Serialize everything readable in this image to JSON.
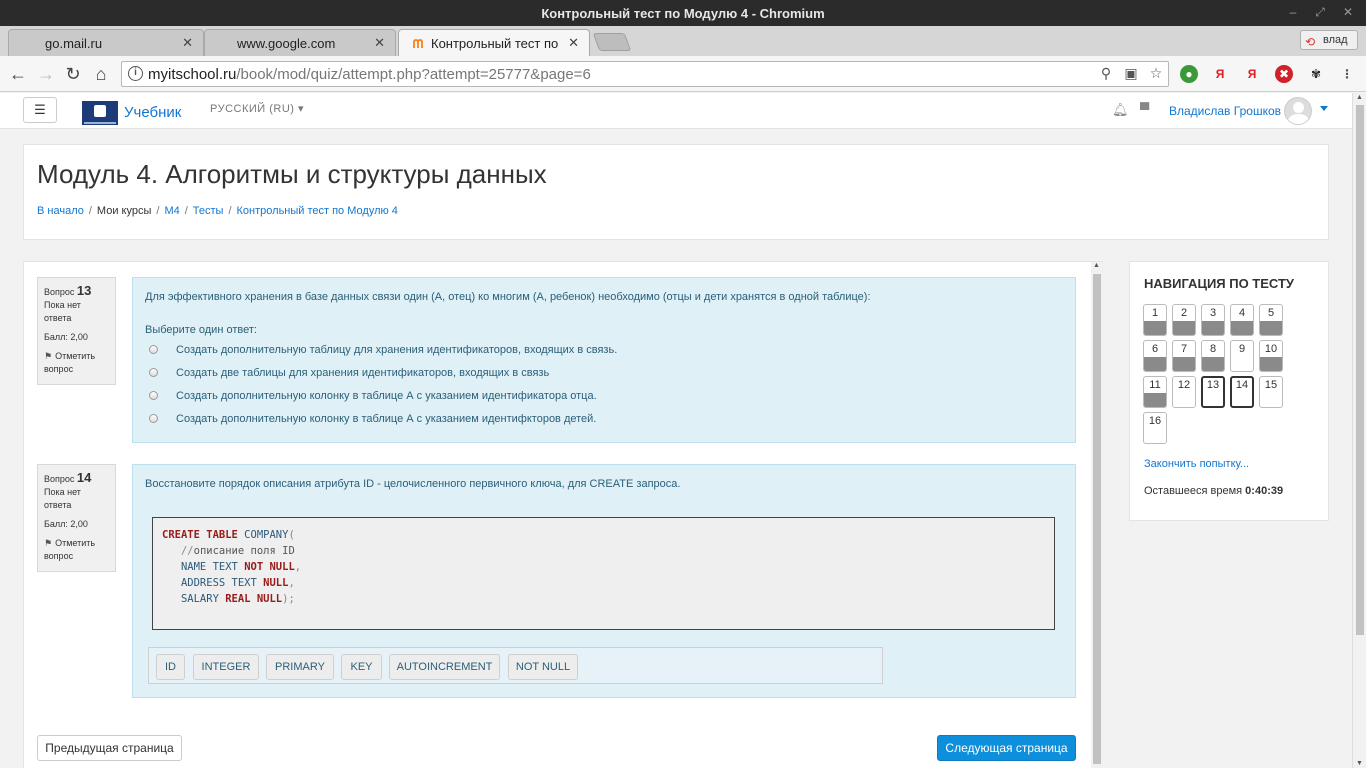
{
  "window": {
    "title": "Контрольный тест по Модулю 4 - Chromium"
  },
  "tabs": [
    {
      "label": "go.mail.ru",
      "active": false
    },
    {
      "label": "www.google.com",
      "active": false
    },
    {
      "label": "Контрольный тест по",
      "active": true
    }
  ],
  "extension_badge": "влад",
  "toolbar": {
    "url_host": "myitschool.ru",
    "url_path": "/book/mod/quiz/attempt.php?attempt=25777&page=6"
  },
  "site": {
    "menu_icon": "☰",
    "brand": "Учебник",
    "language": "РУССКИЙ (RU)",
    "user_name": "Владислав Грошков"
  },
  "header": {
    "title": "Модуль 4. Алгоритмы и структуры данных",
    "breadcrumbs": [
      "В начало",
      "Мои курсы",
      "М4",
      "Тесты",
      "Контрольный тест по Модулю 4"
    ]
  },
  "questions": [
    {
      "label": "Вопрос",
      "number": "13",
      "status_line1": "Пока нет",
      "status_line2": "ответа",
      "score": "Балл: 2,00",
      "flag_line1": "Отметить",
      "flag_line2": "вопрос",
      "text": "Для эффективного хранения в базе данных связи один (А, отец) ко многим (А, ребенок) необходимо (отцы и дети хранятся в одной таблице):",
      "prompt": "Выберите один ответ:",
      "options": [
        "Создать дополнительную таблицу для хранения идентификаторов, входящих в связь.",
        "Создать две таблицы для хранения идентификаторов, входящих в связь",
        "Создать дополнительную колонку в таблице А с указанием идентификатора отца.",
        "Создать дополнительную колонку в таблице А с указанием идентифкторов детей."
      ]
    },
    {
      "label": "Вопрос",
      "number": "14",
      "status_line1": "Пока нет",
      "status_line2": "ответа",
      "score": "Балл: 2,00",
      "flag_line1": "Отметить",
      "flag_line2": "вопрос",
      "text": "Восстановите порядок описания атрибута ID - целочисленного первичного ключа, для CREATE запроса.",
      "code": {
        "l1_kw": "CREATE TABLE",
        "l1_rest": " COMPANY",
        "l1_paren": "(",
        "l2_slash": "//",
        "l2_rest": "описание поля ID",
        "l3_a": "NAME TEXT ",
        "l3_kw": "NOT NULL",
        "l3_p": ",",
        "l4_a": "ADDRESS TEXT ",
        "l4_kw": "NULL",
        "l4_p": ",",
        "l5_a": "SALARY ",
        "l5_kw": "REAL NULL",
        "l5_p": ");"
      },
      "chips": [
        "ID",
        "INTEGER",
        "PRIMARY",
        "KEY",
        "AUTOINCREMENT",
        "NOT NULL"
      ]
    }
  ],
  "buttons": {
    "prev": "Предыдущая страница",
    "next": "Следующая страница"
  },
  "quiz_nav": {
    "title": "НАВИГАЦИЯ ПО ТЕСТУ",
    "items": [
      {
        "n": "1",
        "state": "answered"
      },
      {
        "n": "2",
        "state": "answered"
      },
      {
        "n": "3",
        "state": "answered"
      },
      {
        "n": "4",
        "state": "answered"
      },
      {
        "n": "5",
        "state": "answered"
      },
      {
        "n": "6",
        "state": "answered"
      },
      {
        "n": "7",
        "state": "answered"
      },
      {
        "n": "8",
        "state": "answered"
      },
      {
        "n": "9",
        "state": "empty"
      },
      {
        "n": "10",
        "state": "answered"
      },
      {
        "n": "11",
        "state": "answered"
      },
      {
        "n": "12",
        "state": "empty"
      },
      {
        "n": "13",
        "state": "current"
      },
      {
        "n": "14",
        "state": "current"
      },
      {
        "n": "15",
        "state": "empty"
      },
      {
        "n": "16",
        "state": "empty"
      }
    ],
    "finish": "Закончить попытку...",
    "time_label": "Оставшееся время",
    "time_value": "0:40:39"
  },
  "colors": {
    "link": "#1177d1",
    "primary_button": "#0e8fdb",
    "question_bg": "#dff0f7",
    "keyword": "#9a1b1b"
  }
}
